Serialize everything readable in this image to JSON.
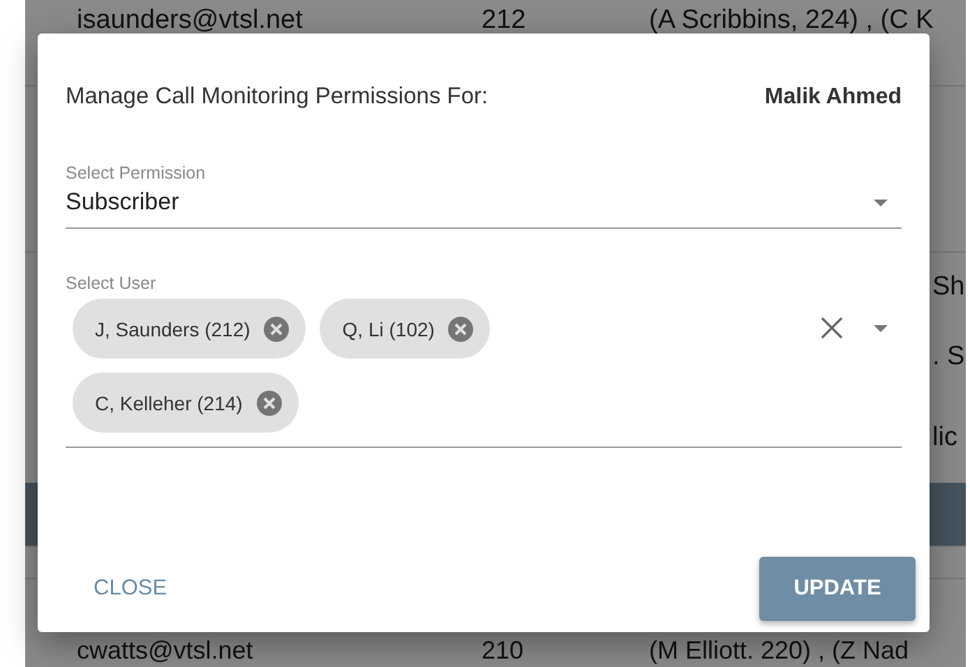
{
  "background_table": {
    "rows": [
      {
        "kind": "full",
        "email": "isaunders@vtsl.net",
        "extension": "212",
        "column_3": "(A Scribbins, 224) , (C K"
      },
      {
        "kind": "blank"
      },
      {
        "kind": "fragment",
        "column_3": "Sh"
      },
      {
        "kind": "fragment",
        "column_3": ". S"
      },
      {
        "kind": "fragment",
        "column_3": "lic"
      },
      {
        "kind": "band"
      },
      {
        "kind": "blank"
      },
      {
        "kind": "full",
        "email": "cwatts@vtsl.net",
        "extension": "210",
        "column_3": "(M Elliott. 220) , (Z Nad"
      }
    ]
  },
  "dialog": {
    "title": "Manage Call Monitoring Permissions For:",
    "user_name": "Malik Ahmed",
    "permission_select": {
      "label": "Select Permission",
      "value": "Subscriber"
    },
    "user_select": {
      "label": "Select User",
      "chips": [
        "J, Saunders (212)",
        "Q, Li (102)",
        "C, Kelleher (214)"
      ]
    },
    "buttons": [
      {
        "kind": "text",
        "label": "CLOSE"
      },
      {
        "kind": "raised",
        "label": "UPDATE"
      }
    ]
  }
}
